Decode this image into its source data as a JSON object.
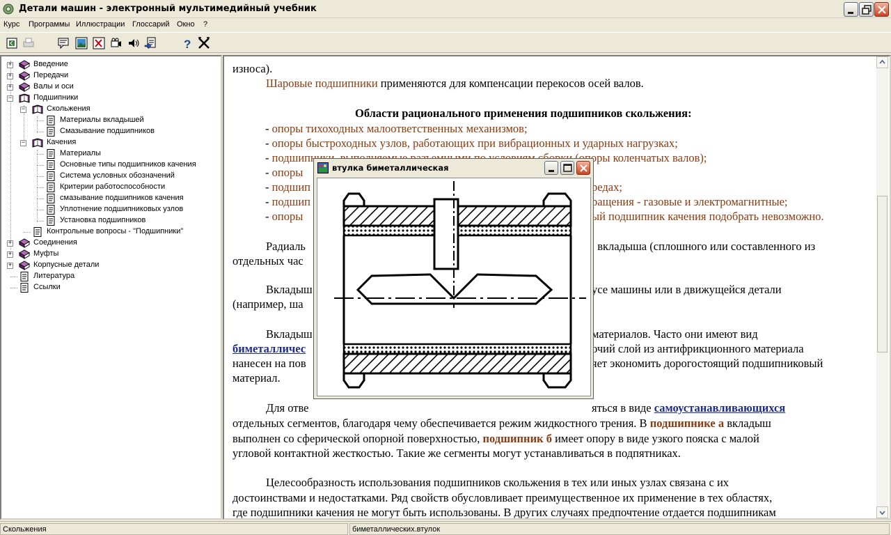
{
  "window": {
    "title": "Детали машин - электронный мультимедийный учебник"
  },
  "menu": [
    "Курс",
    "Программы",
    "Иллюстрации",
    "Глоссарий",
    "Окно",
    "?"
  ],
  "toolbar": {
    "icons": [
      "back-icon",
      "print-icon",
      "comment-icon",
      "image-icon",
      "formula-icon",
      "video-icon",
      "sound-icon",
      "notes-icon",
      "help-icon",
      "exit-icon"
    ],
    "help_glyph": "?"
  },
  "tree": {
    "items": [
      {
        "label": "Введение",
        "expander": "+"
      },
      {
        "label": "Передачи",
        "expander": "+"
      },
      {
        "label": "Валы и оси",
        "expander": "+"
      },
      {
        "label": "Подшипники",
        "expander": "−"
      },
      {
        "label": "Скольжения",
        "expander": "−"
      },
      {
        "label": "Материалы вкладышей"
      },
      {
        "label": "Смазывание подшипников"
      },
      {
        "label": "Качения",
        "expander": "−"
      },
      {
        "label": "Материалы"
      },
      {
        "label": "Основные типы подшипников качения"
      },
      {
        "label": "Система условных обозначений"
      },
      {
        "label": "Критерии работоспособности"
      },
      {
        "label": "смазывание подшипников качения"
      },
      {
        "label": "Уплотнение подшипниковых узлов"
      },
      {
        "label": "Установка подшипников"
      },
      {
        "label": "Контрольные вопросы - \"Подшипники\""
      },
      {
        "label": "Соединения",
        "expander": "+"
      },
      {
        "label": "Муфты",
        "expander": "+"
      },
      {
        "label": "Корпусные детали",
        "expander": "+"
      },
      {
        "label": "Литература"
      },
      {
        "label": "Ссылки"
      }
    ]
  },
  "content": {
    "l1": "износа).",
    "l2a": "Шаровые подшипники",
    "l2b": " применяются для компенсации перекосов осей валов.",
    "heading": "Области рационального применения подшипников скольжения:",
    "b1": "опоры тихоходных малоответственных механизмов;",
    "b2": "опоры быстроходных узлов, работающих при вибрационных и ударных нагрузках;",
    "b3a": "подшипники, выполняемые разъемными по условиям сборки (опоры коленчатых валов);",
    "b4a": "опоры",
    "b5a": "подшип",
    "b5b": "редах;",
    "b6a": "подшип",
    "b6b": "ращения - газовые и электромагнитные;",
    "b7a": "опоры",
    "b7b": "ый подшипник качения подобрать невозможно.",
    "bullet": "-",
    "p3a": "Радиаль",
    "p3b": ", вкладыша (сплошного или составленного из",
    "p3c": "отдельных час",
    "p4a": "Вкладыш",
    "p4b": "усе машины или в движущейся детали",
    "p4c": "(например, ша",
    "p5a": "Вкладыш",
    "p5b": "материалов. Часто они имеют вид",
    "p5c": "биметалличес",
    "p5d": "очий слой из антифрикционного материала",
    "p5e": "нанесен на пов",
    "p5f": "яет экономить дорогостоящий подшипниковый",
    "p5g": "материал.",
    "p6a": "Для отве",
    "p6b": "яться в виде ",
    "p6link": "самоустанавливающихся",
    "p6c": "отдельных сегментов, благодаря чему обеспечивается режим жидкостного трения. В ",
    "p6d": "подшипнике а",
    "p6e": " вкладыш",
    "p6f": "выполнен со сферической опорной поверхностью, ",
    "p6g": "подшипник б",
    "p6h": " имеет опору в виде узкого пояска с малой",
    "p6i": "угловой контактной жесткостью. Такие же сегменты могут устанавливаться в подпятниках.",
    "p7a": "Целесообразность использования подшипников скольжения в тех или иных узлах связана с их",
    "p7b": "достоинствами и недостатками. Ряд свойств обусловливает преимущественное их применение в тех областях,",
    "p7c": "где подшипники качения не могут быть использованы. В других случаях предпочтение отдается подшипникам"
  },
  "popup": {
    "title": "втулка биметаллическая"
  },
  "status": {
    "left": "Скольжения",
    "right": "биметаллических.втулок"
  },
  "colors": {
    "link": "#1c2b8c",
    "term": "#8b3a0f",
    "bg": "#ece9d8"
  }
}
